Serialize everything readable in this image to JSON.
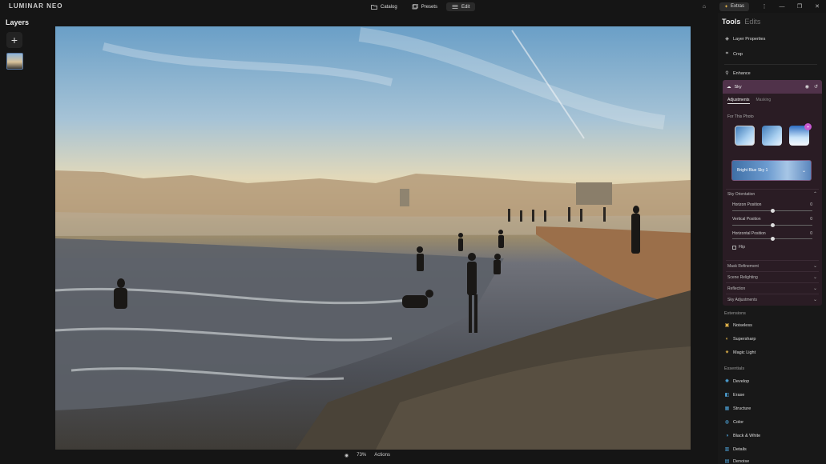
{
  "app": {
    "logo": "LUMINAR NEO"
  },
  "nav": {
    "tabs": [
      {
        "label": "Catalog"
      },
      {
        "label": "Presets"
      },
      {
        "label": "Edit"
      }
    ],
    "active": "Edit"
  },
  "titlebar": {
    "extras_label": "Extras"
  },
  "layers": {
    "title": "Layers",
    "add_symbol": "+"
  },
  "canvas": {
    "zoom": "73%",
    "actions_label": "Actions"
  },
  "panel": {
    "tools_title": "Tools",
    "edits_title": "Edits",
    "items_top": [
      {
        "label": "Layer Properties"
      },
      {
        "label": "Crop"
      },
      {
        "label": "Enhance"
      }
    ],
    "sky": {
      "title": "Sky",
      "tabs": [
        "Adjustments",
        "Masking"
      ],
      "for_this_photo": "For This Photo",
      "selected_sky": "Bright Blue Sky 1",
      "orientation_title": "Sky Orientation",
      "sliders": [
        {
          "label": "Horizon Position",
          "value": "0",
          "level": 0.5
        },
        {
          "label": "Vertical Position",
          "value": "0",
          "level": 0.5
        },
        {
          "label": "Horizontal Position",
          "value": "0",
          "level": 0.5
        }
      ],
      "flip_label": "Flip",
      "sections": [
        "Mask Refinement",
        "Scene Relighting",
        "Reflection",
        "Sky Adjustments"
      ]
    },
    "extensions_title": "Extensions",
    "extensions": [
      {
        "label": "Noiseless"
      },
      {
        "label": "Supersharp"
      },
      {
        "label": "Magic Light"
      }
    ],
    "essentials_title": "Essentials",
    "essentials": [
      {
        "label": "Develop"
      },
      {
        "label": "Erase"
      },
      {
        "label": "Structure"
      },
      {
        "label": "Color"
      },
      {
        "label": "Black & White"
      },
      {
        "label": "Details"
      },
      {
        "label": "Denoise"
      }
    ]
  },
  "colors": {
    "accent": "#c75ad1",
    "sky_header": "#50324a",
    "panel_bg": "#181818"
  }
}
